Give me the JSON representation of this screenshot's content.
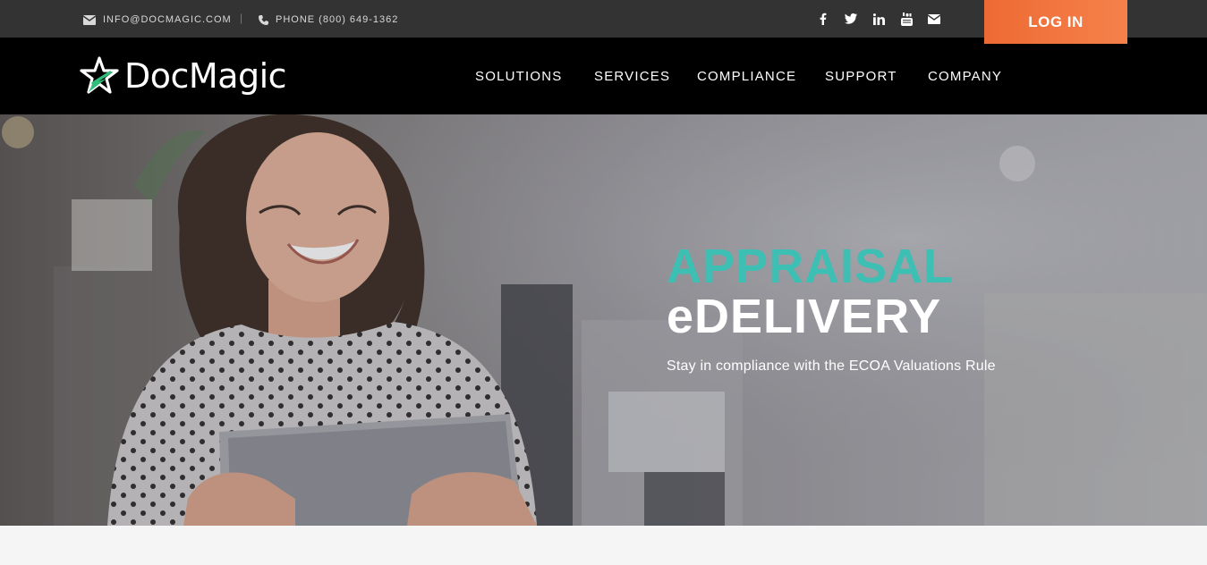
{
  "topbar": {
    "email_text": "INFO@DOCMAGIC.COM",
    "separator": "|",
    "phone_text": "PHONE (800) 649-1362",
    "social_icons": [
      "facebook-icon",
      "twitter-icon",
      "linkedin-icon",
      "youtube-icon",
      "envelope-icon"
    ],
    "login_label": "LOG IN"
  },
  "nav": {
    "logo_text": "DocMagic",
    "items": [
      "SOLUTIONS",
      "SERVICES",
      "COMPLIANCE",
      "SUPPORT",
      "COMPANY"
    ]
  },
  "hero": {
    "headline_line1": "APPRAISAL",
    "headline_line2": "eDELIVERY",
    "subtitle": "Stay in compliance with the ECOA Valuations Rule"
  },
  "colors": {
    "accent_teal": "#3dbfb3",
    "login_orange": "#ef6c35",
    "topbar_bg": "#333333",
    "nav_bg": "#000000",
    "logo_star_green": "#2fbf7a"
  }
}
